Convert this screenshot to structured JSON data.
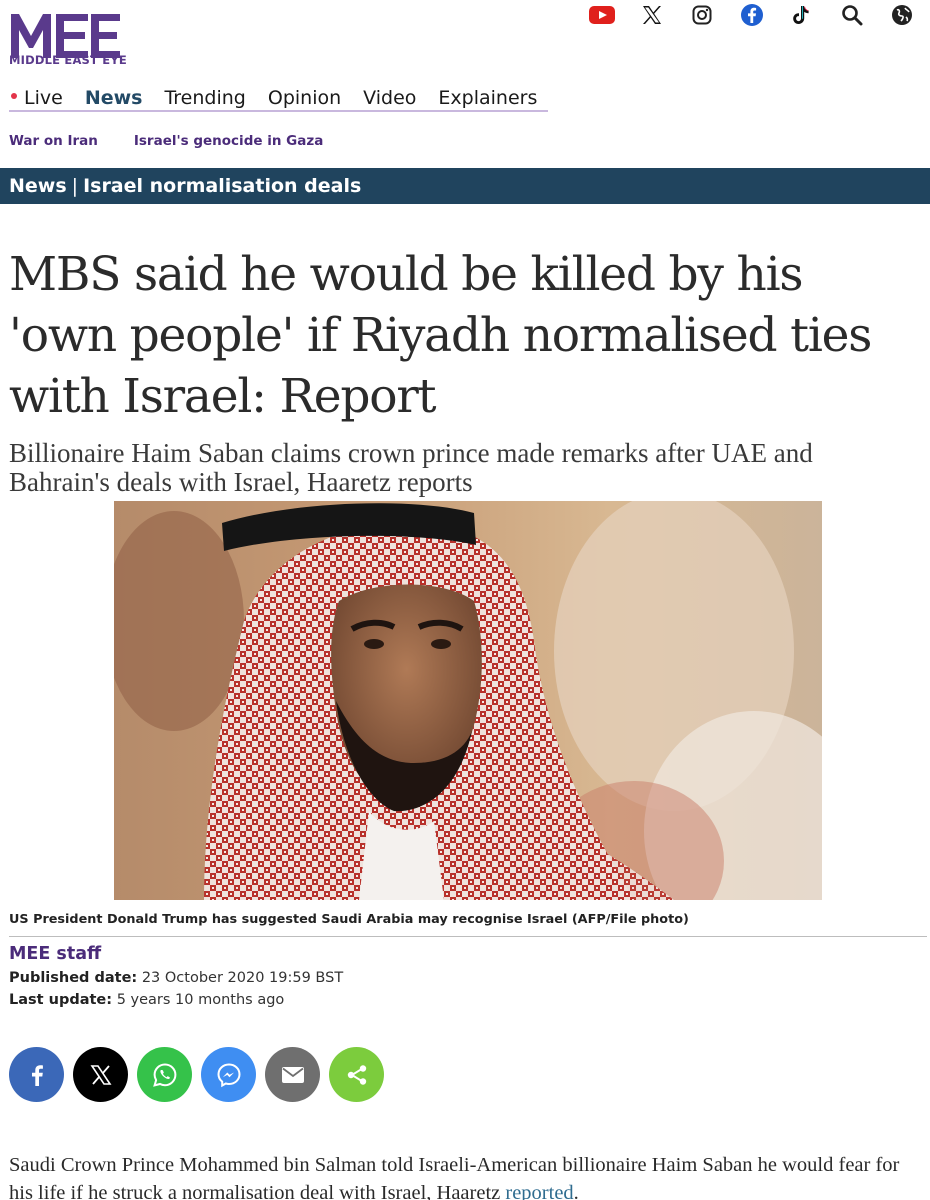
{
  "brand": {
    "name": "MIDDLE EAST EYE",
    "color": "#5a3a8c"
  },
  "social_icons": [
    "youtube-icon",
    "x-icon",
    "instagram-icon",
    "facebook-icon",
    "tiktok-icon",
    "search-icon",
    "globe-icon"
  ],
  "nav": {
    "items": [
      {
        "label": "Live",
        "live": true
      },
      {
        "label": "News",
        "active": true
      },
      {
        "label": "Trending"
      },
      {
        "label": "Opinion"
      },
      {
        "label": "Video"
      },
      {
        "label": "Explainers"
      }
    ]
  },
  "subnav": {
    "items": [
      "War on Iran",
      "Israel's genocide in Gaza"
    ]
  },
  "section": {
    "category": "News",
    "separator": "|",
    "topic": "Israel normalisation deals",
    "bar_color": "#20445e"
  },
  "article": {
    "headline": "MBS said he would be killed by his 'own people' if Riyadh normalised ties with Israel: Report",
    "standfirst": "Billionaire Haim Saban claims crown prince made remarks after UAE and Bahrain's deals with Israel, Haaretz reports",
    "caption": "US President Donald Trump has suggested Saudi Arabia may recognise Israel (AFP/File photo)",
    "author": "MEE staff",
    "published_label": "Published date:",
    "published_value": "23 October 2020 19:59 BST",
    "updated_label": "Last update:",
    "updated_value": "5 years 10 months ago",
    "body_text": "Saudi Crown Prince Mohammed bin Salman told Israeli-American billionaire Haim Saban he would fear for his life if he struck a normalisation deal with Israel, Haaretz ",
    "body_link": "reported",
    "body_end": "."
  },
  "share_buttons": [
    {
      "name": "facebook-share-button",
      "icon": "facebook-icon",
      "color": "#3b68b8"
    },
    {
      "name": "x-share-button",
      "icon": "x-icon",
      "color": "#000000"
    },
    {
      "name": "whatsapp-share-button",
      "icon": "whatsapp-icon",
      "color": "#35c24a"
    },
    {
      "name": "messenger-share-button",
      "icon": "messenger-icon",
      "color": "#3f8ef2"
    },
    {
      "name": "email-share-button",
      "icon": "email-icon",
      "color": "#6f6f6f"
    },
    {
      "name": "share-button",
      "icon": "share-icon",
      "color": "#7ccc3d"
    }
  ]
}
